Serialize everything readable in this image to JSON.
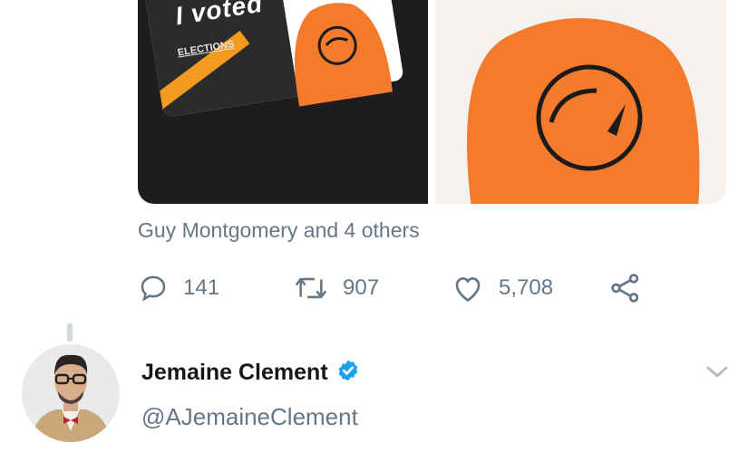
{
  "tweet": {
    "media": {
      "left_image": {
        "sticker_text": "I voted",
        "sticker_subtext": "ELECTIONS",
        "colors": {
          "background": "#1b1b1d",
          "figure": "#f47a2c",
          "accent": "#f29b1f"
        }
      },
      "right_image": {
        "colors": {
          "background": "#f5f1ee",
          "figure": "#f47a2c"
        }
      }
    },
    "liked_by": "Guy Montgomery and 4 others",
    "actions": {
      "replies": {
        "icon": "reply-icon",
        "count": "141"
      },
      "retweets": {
        "icon": "retweet-icon",
        "count": "907"
      },
      "likes": {
        "icon": "heart-icon",
        "count": "5,708"
      },
      "share": {
        "icon": "share-icon"
      }
    }
  },
  "next_tweet": {
    "author": {
      "name": "Jemaine Clement",
      "handle": "@AJemaineClement",
      "verified": true,
      "verified_color": "#1da1f2"
    },
    "menu_icon": "chevron-down-icon"
  },
  "colors": {
    "text_primary": "#14171a",
    "text_secondary": "#657786",
    "accent": "#1da1f2"
  }
}
